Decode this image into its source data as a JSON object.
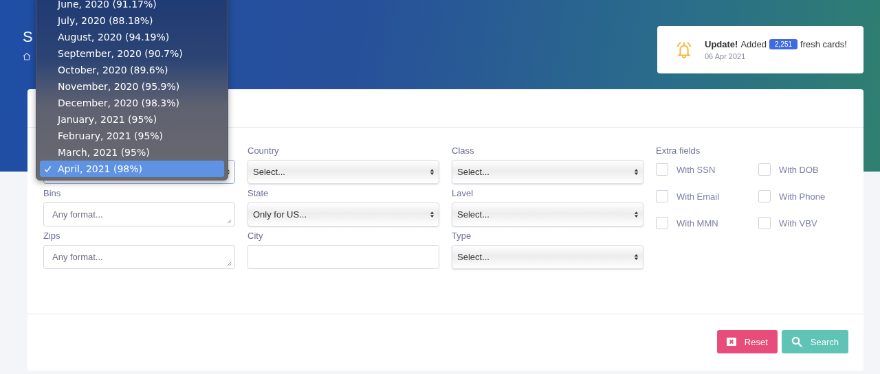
{
  "page": {
    "title": "S"
  },
  "notification": {
    "title": "Update!",
    "before": "Added",
    "count": "2,251",
    "after": "fresh cards!",
    "date": "06 Apr 2021"
  },
  "dropdown": {
    "options": [
      {
        "label": "June, 2020 (91.17%)",
        "selected": false
      },
      {
        "label": "July, 2020 (88.18%)",
        "selected": false
      },
      {
        "label": "August, 2020 (94.19%)",
        "selected": false
      },
      {
        "label": "September, 2020 (90.7%)",
        "selected": false
      },
      {
        "label": "October, 2020 (89.6%)",
        "selected": false
      },
      {
        "label": "November, 2020 (95.9%)",
        "selected": false
      },
      {
        "label": "December, 2020 (98.3%)",
        "selected": false
      },
      {
        "label": "January, 2021 (95%)",
        "selected": false
      },
      {
        "label": "February, 2021 (95%)",
        "selected": false
      },
      {
        "label": "March, 2021 (95%)",
        "selected": false
      },
      {
        "label": "April, 2021 (98%)",
        "selected": true
      }
    ]
  },
  "columns": [
    [
      {
        "kind": "select",
        "focused": true
      },
      {
        "label": "Bins",
        "kind": "textarea",
        "placeholder": "Any format..."
      },
      {
        "label": "Zips",
        "kind": "textarea",
        "placeholder": "Any format..."
      }
    ],
    [
      {
        "label": "Country",
        "kind": "select",
        "value": "Select..."
      },
      {
        "label": "State",
        "kind": "select",
        "value": "Only for US..."
      },
      {
        "label": "City",
        "kind": "input"
      }
    ],
    [
      {
        "label": "Class",
        "kind": "select",
        "value": "Select..."
      },
      {
        "label": "Lavel",
        "kind": "select",
        "value": "Select..."
      },
      {
        "label": "Type",
        "kind": "select",
        "value": "Select..."
      }
    ]
  ],
  "extra_fields": {
    "label": "Extra fields",
    "options": [
      {
        "label": "With SSN",
        "checked": false
      },
      {
        "label": "With DOB",
        "checked": false
      },
      {
        "label": "With Email",
        "checked": false
      },
      {
        "label": "With Phone",
        "checked": false
      },
      {
        "label": "With MMN",
        "checked": false
      },
      {
        "label": "With VBV",
        "checked": false
      }
    ]
  },
  "buttons": [
    {
      "label": "Reset",
      "kind": "reset"
    },
    {
      "label": "Search",
      "kind": "search"
    }
  ]
}
